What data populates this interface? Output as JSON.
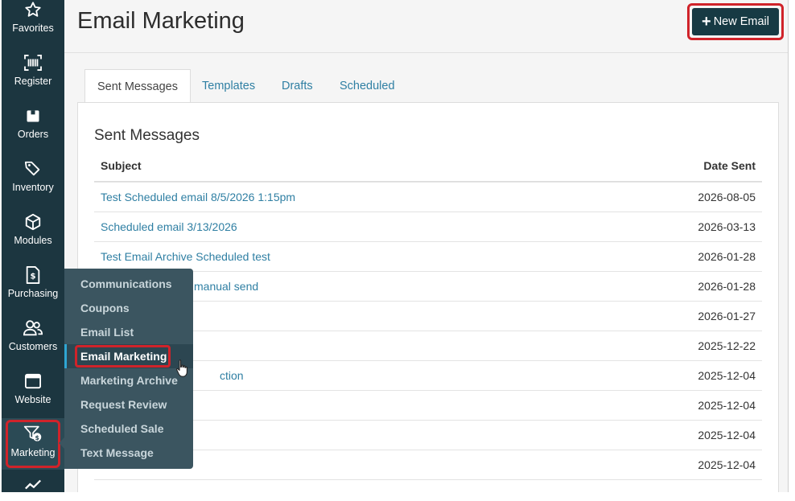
{
  "sidebar": {
    "items": [
      {
        "label": "Favorites",
        "icon": "star-icon"
      },
      {
        "label": "Register",
        "icon": "barcode-icon"
      },
      {
        "label": "Orders",
        "icon": "box-icon"
      },
      {
        "label": "Inventory",
        "icon": "tags-icon"
      },
      {
        "label": "Modules",
        "icon": "cube-icon"
      },
      {
        "label": "Purchasing",
        "icon": "invoice-icon"
      },
      {
        "label": "Customers",
        "icon": "users-icon"
      },
      {
        "label": "Website",
        "icon": "window-icon"
      },
      {
        "label": "Marketing",
        "icon": "funnel-dollar-icon"
      }
    ]
  },
  "submenu": {
    "items": [
      "Communications",
      "Coupons",
      "Email List",
      "Email Marketing",
      "Marketing Archive",
      "Request Review",
      "Scheduled Sale",
      "Text Message"
    ],
    "current": "Email Marketing"
  },
  "header": {
    "title": "Email Marketing",
    "new_button": "New Email"
  },
  "tabs": [
    "Sent Messages",
    "Templates",
    "Drafts",
    "Scheduled"
  ],
  "panel": {
    "title": "Sent Messages",
    "columns": {
      "subject": "Subject",
      "date": "Date Sent"
    },
    "rows": [
      {
        "subject": "Test Scheduled email 8/5/2026 1:15pm",
        "date": "2026-08-05"
      },
      {
        "subject": "Scheduled email 3/13/2026",
        "date": "2026-03-13"
      },
      {
        "subject": "Test Email Archive Scheduled test",
        "date": "2026-01-28"
      },
      {
        "subject": "manual send",
        "date": "2026-01-28"
      },
      {
        "subject": "",
        "date": "2026-01-27"
      },
      {
        "subject": "",
        "date": "2025-12-22"
      },
      {
        "subject": "ction",
        "date": "2025-12-04"
      },
      {
        "subject": "",
        "date": "2025-12-04"
      },
      {
        "subject": "",
        "date": "2025-12-04"
      },
      {
        "subject": "",
        "date": "2025-12-04"
      }
    ]
  },
  "colors": {
    "sidebar": "#1c3640",
    "flyout": "#3b5560",
    "link": "#2f7fa3",
    "highlight": "#d0232a",
    "button": "#173a44"
  }
}
